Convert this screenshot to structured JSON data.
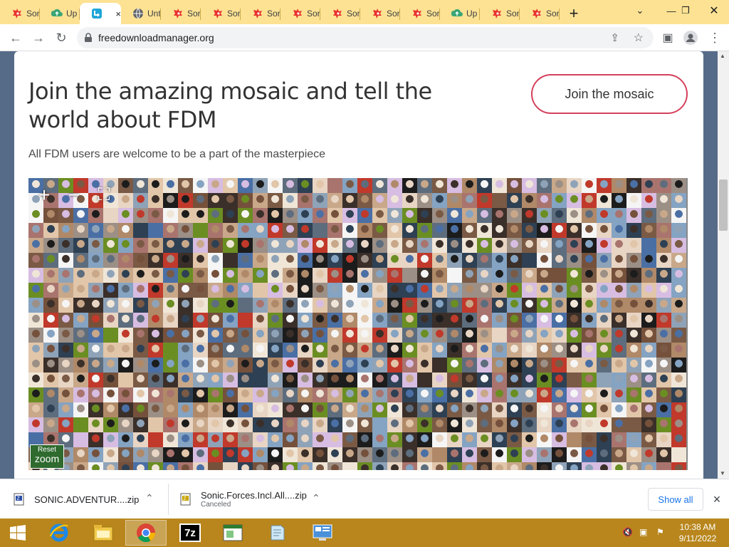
{
  "browser": {
    "tabs": [
      {
        "label": "Sor",
        "icon": "sonic-favicon"
      },
      {
        "label": "Up",
        "icon": "upload-favicon"
      },
      {
        "label": "",
        "icon": "fdm-favicon",
        "active": true
      },
      {
        "label": "Unt",
        "icon": "globe-favicon"
      },
      {
        "label": "Sor",
        "icon": "sonic-favicon"
      },
      {
        "label": "Sor",
        "icon": "sonic-favicon"
      },
      {
        "label": "Sor",
        "icon": "sonic-favicon"
      },
      {
        "label": "Sor",
        "icon": "sonic-favicon"
      },
      {
        "label": "Sor",
        "icon": "sonic-favicon"
      },
      {
        "label": "Sor",
        "icon": "sonic-favicon"
      },
      {
        "label": "Sor",
        "icon": "sonic-favicon"
      },
      {
        "label": "Up",
        "icon": "upload-favicon"
      },
      {
        "label": "Sor",
        "icon": "sonic-favicon"
      },
      {
        "label": "Sor",
        "icon": "sonic-favicon"
      }
    ],
    "new_tab": "+",
    "close_tab": "×",
    "url": "freedownloadmanager.org",
    "colors": {
      "tabstrip": "#fde293",
      "sonic": "#e8332d",
      "upload": "#3aa676",
      "fdm": "#1fa6d6"
    }
  },
  "page": {
    "headline": "Join the amazing mosaic and tell the world about FDM",
    "subline": "All FDM users are welcome to be a part of the masterpiece",
    "join_button": "Join the mosaic",
    "zoom_in": "+",
    "zoom_out": "−",
    "fullscreen": "⛶",
    "reset_zoom_top": "Reset",
    "reset_zoom_bottom": "zoom",
    "colors": {
      "background": "#566b88",
      "accent": "#d5415c"
    }
  },
  "downloads": {
    "items": [
      {
        "name": "SONIC.ADVENTUR....zip",
        "status": ""
      },
      {
        "name": "Sonic.Forces.Incl.All....zip",
        "status": "Canceled"
      }
    ],
    "show_all": "Show all",
    "close": "×"
  },
  "taskbar": {
    "apps": [
      "Start",
      "Internet Explorer",
      "File Explorer",
      "Google Chrome",
      "7-Zip",
      "Application",
      "Notepad",
      "Control Panel"
    ],
    "time": "10:38 AM",
    "date": "9/11/2022"
  }
}
